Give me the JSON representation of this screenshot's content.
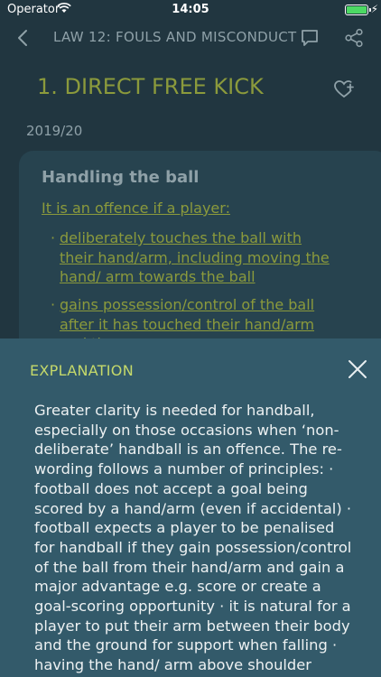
{
  "status_bar": {
    "carrier": "Operator",
    "time": "14:05",
    "battery_level": 1.0
  },
  "nav": {
    "title": "LAW 12: FOULS AND MISCONDUCT"
  },
  "section": {
    "heading": "1. DIRECT FREE KICK",
    "season": "2019/20"
  },
  "card": {
    "title": "Handling the ball",
    "intro": "It is an offence if a player:",
    "bullets": [
      {
        "dot": "·",
        "text": "deliberately touches the ball with their hand/arm, including moving the hand/ arm towards the ball"
      },
      {
        "dot": "·",
        "text": "gains possession/control of the ball after it has touched their hand/arm and then:"
      }
    ]
  },
  "explanation": {
    "title": "EXPLANATION",
    "body": "Greater clarity is needed for handball, especially on those occasions when ‘non-deliberate’ handball is an offence. The re-wording follows a number of principles: · football does not accept a goal being scored by a hand/arm (even if accidental) · football expects a player to be penalised for handball if they gain possession/control of the ball from their hand/arm and gain a major advantage e.g. score or create a goal-scoring opportunity · it is natural for a player to put their arm between their body and the ground for support when falling · having the hand/ arm above shoulder height is rarely a ‘natural’"
  },
  "colors": {
    "accent": "#8b9a3c",
    "sheet": "#335a6a",
    "background": "#213640"
  }
}
